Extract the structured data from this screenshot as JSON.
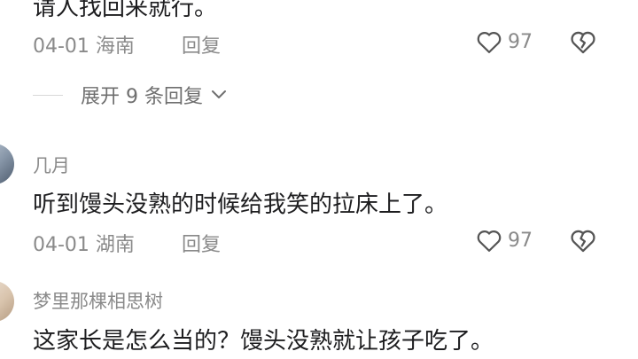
{
  "comments": [
    {
      "text": "请人找回来就行。",
      "date_location": "04-01 海南",
      "reply_label": "回复",
      "likes": "97"
    },
    {
      "username": "几月",
      "text": "听到馒头没熟的时候给我笑的拉床上了。",
      "date_location": "04-01 湖南",
      "reply_label": "回复",
      "likes": "97"
    },
    {
      "username": "梦里那棵相思树",
      "text": "这家长是怎么当的？馒头没熟就让孩子吃了。"
    }
  ],
  "expand_replies": {
    "label": "展开 9 条回复"
  },
  "icons": {
    "like": "heart-outline-icon",
    "dislike": "broken-heart-icon",
    "expand": "chevron-down-icon"
  },
  "colors": {
    "text_primary": "#1d1d1f",
    "text_secondary": "#8a8a8a",
    "icon": "#555555"
  }
}
